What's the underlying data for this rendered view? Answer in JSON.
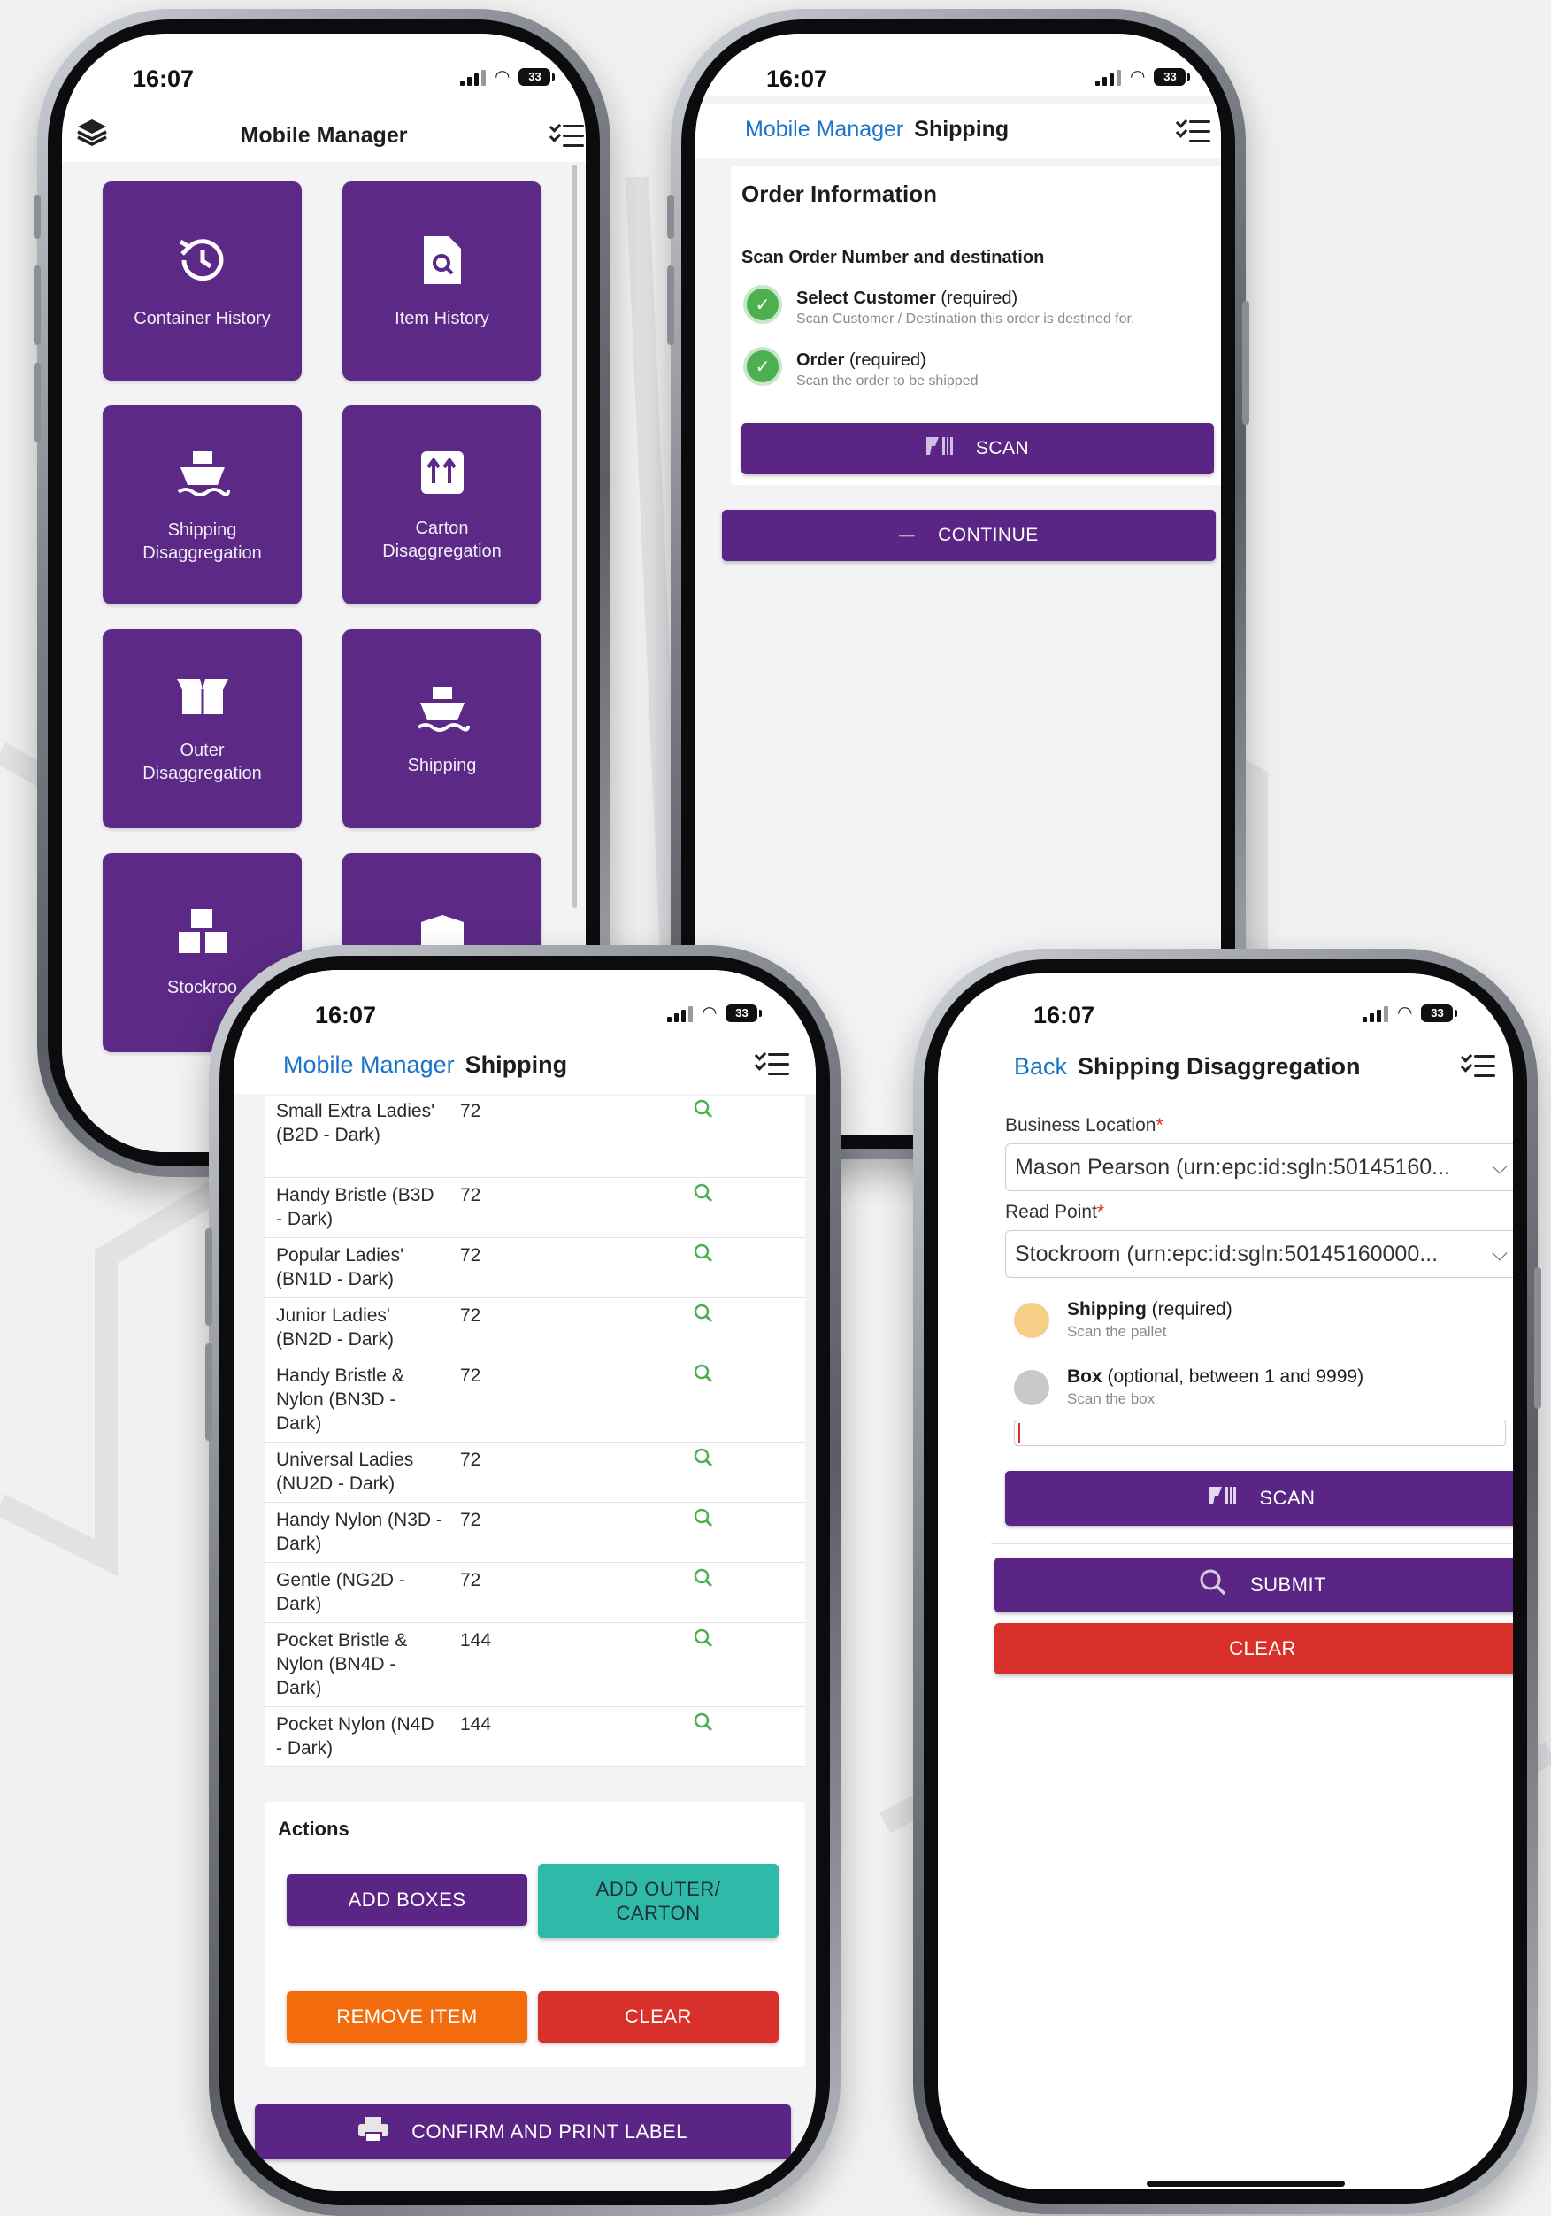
{
  "status": {
    "time": "16:07",
    "battery": "33"
  },
  "p1": {
    "title": "Mobile Manager",
    "tiles": [
      {
        "label": "Container History",
        "icon": "history-icon"
      },
      {
        "label": "Item History",
        "icon": "document-search-icon"
      },
      {
        "label": "Shipping Disaggregation",
        "icon": "ship-icon"
      },
      {
        "label": "Carton Disaggregation",
        "icon": "carton-arrows-icon"
      },
      {
        "label": "Outer Disaggregation",
        "icon": "open-box-icon"
      },
      {
        "label": "Shipping",
        "icon": "ship-icon"
      },
      {
        "label": "Stockroo",
        "icon": "boxes-icon"
      },
      {
        "label": "",
        "icon": "box-icon"
      }
    ]
  },
  "p2": {
    "crumb": "Mobile Manager",
    "title": "Shipping",
    "section": "Order Information",
    "subsection": "Scan Order Number and destination",
    "steps": [
      {
        "label": "Select Customer",
        "note": " (required)",
        "hint": "Scan Customer / Destination this order is destined for."
      },
      {
        "label": "Order",
        "note": " (required)",
        "hint": "Scan the order to be shipped"
      }
    ],
    "scan": "SCAN",
    "continue": "CONTINUE"
  },
  "p3": {
    "crumb": "Mobile Manager",
    "title": "Shipping",
    "rows": [
      {
        "name": "Small Extra Ladies' (B2D - Dark)",
        "qty": "72"
      },
      {
        "name": "Handy Bristle (B3D - Dark)",
        "qty": "72"
      },
      {
        "name": "Popular Ladies' (BN1D - Dark)",
        "qty": "72"
      },
      {
        "name": "Junior Ladies' (BN2D - Dark)",
        "qty": "72"
      },
      {
        "name": "Handy Bristle & Nylon (BN3D - Dark)",
        "qty": "72"
      },
      {
        "name": "Universal Ladies (NU2D - Dark)",
        "qty": "72"
      },
      {
        "name": "Handy Nylon (N3D - Dark)",
        "qty": "72"
      },
      {
        "name": "Gentle (NG2D - Dark)",
        "qty": "72"
      },
      {
        "name": "Pocket Bristle & Nylon (BN4D - Dark)",
        "qty": "144"
      },
      {
        "name": "Pocket Nylon (N4D - Dark)",
        "qty": "144"
      }
    ],
    "actions": "Actions",
    "add_boxes": "ADD BOXES",
    "add_outer": "ADD OUTER/ CARTON",
    "remove_item": "REMOVE ITEM",
    "clear": "CLEAR",
    "confirm": "CONFIRM AND PRINT LABEL"
  },
  "p4": {
    "back": "Back",
    "title": "Shipping Disaggregation",
    "business_location_label": "Business Location",
    "business_location_value": "Mason Pearson (urn:epc:id:sgln:50145160...",
    "read_point_label": "Read Point",
    "read_point_value": "Stockroom (urn:epc:id:sgln:50145160000...",
    "shipping_label": "Shipping",
    "shipping_note": " (required)",
    "shipping_hint": "Scan the pallet",
    "box_label": "Box",
    "box_note": " (optional, between 1 and 9999)",
    "box_hint": "Scan the box",
    "scan": "SCAN",
    "submit": "SUBMIT",
    "clear": "CLEAR",
    "colors": {
      "shipping_dot": "#f6cf86",
      "box_dot": "#c9c9c9"
    }
  }
}
